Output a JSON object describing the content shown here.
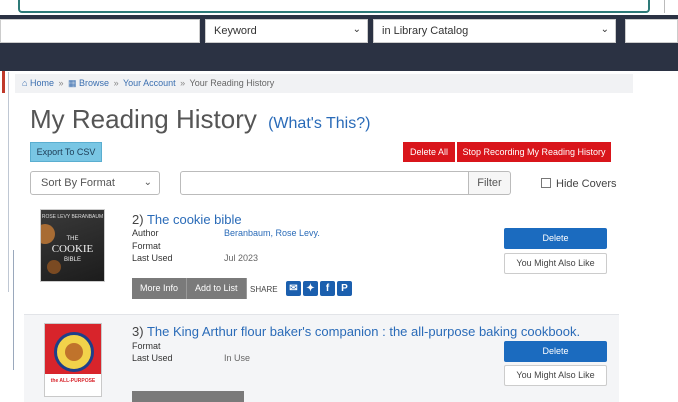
{
  "search": {
    "type_selected": "Keyword",
    "scope_selected": "in Library Catalog"
  },
  "breadcrumb": {
    "home": "Home",
    "browse": "Browse",
    "account": "Your Account",
    "current": "Your Reading History",
    "sep": "»"
  },
  "page": {
    "title": "My Reading History",
    "whats_this": "(What's This?)"
  },
  "actions": {
    "export_csv": "Export To CSV",
    "delete_all": "Delete All",
    "stop_recording": "Stop Recording My Reading History"
  },
  "filters": {
    "sort_selected": "Sort By Format",
    "filter_button": "Filter",
    "hide_covers": "Hide Covers"
  },
  "labels": {
    "author": "Author",
    "format": "Format",
    "last_used": "Last Used",
    "delete": "Delete",
    "you_might_also_like": "You Might Also Like",
    "more_info": "More Info",
    "add_to_list": "Add to List",
    "share": "SHARE"
  },
  "results": [
    {
      "number": "2)",
      "title": "The cookie bible",
      "author": "Beranbaum, Rose Levy.",
      "format": "",
      "last_used": "Jul 2023",
      "cover_top": "ROSE LEVY BERANBAUM",
      "cover_main": "COOKIE",
      "cover_pre": "THE",
      "cover_sub": "BIBLE"
    },
    {
      "number": "3)",
      "title": "The King Arthur flour baker's companion : the all-purpose baking cookbook.",
      "format": "",
      "last_used": "In Use",
      "cover_bottom": "the ALL-PURPOSE"
    }
  ],
  "share_icons": [
    "email-icon",
    "twitter-icon",
    "facebook-icon",
    "pinterest-icon"
  ]
}
